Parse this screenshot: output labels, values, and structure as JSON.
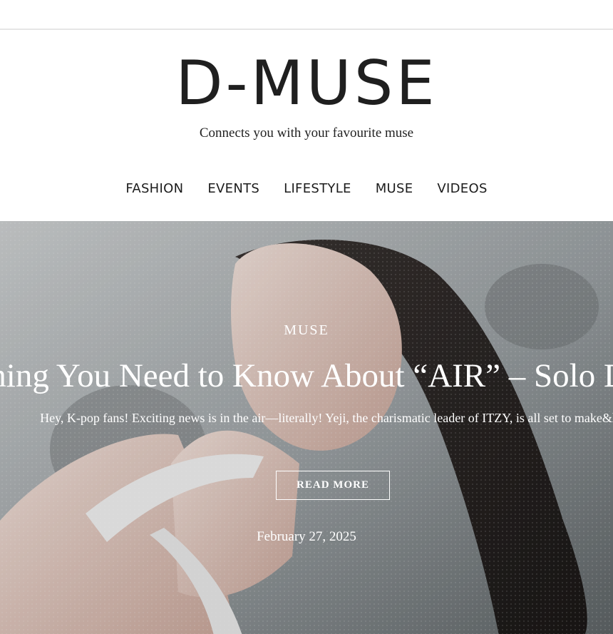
{
  "site": {
    "logo": "D-MUSE",
    "tagline": "Connects you with your favourite muse"
  },
  "nav": {
    "items": [
      {
        "label": "FASHION"
      },
      {
        "label": "EVENTS"
      },
      {
        "label": "LIFESTYLE"
      },
      {
        "label": "MUSE"
      },
      {
        "label": "VIDEOS"
      }
    ]
  },
  "hero": {
    "category": "MUSE",
    "headline": "Everything You Need to Know About “AIR” – Solo Debut",
    "excerpt": "Hey, K-pop fans! Exciting news is in the air—literally! Yeji, the charismatic leader of ITZY, is all set to make&h",
    "button_label": "READ MORE",
    "date": "February 27, 2025"
  },
  "colors": {
    "nav_text": "#1c1c1c",
    "logo_text": "#1f1f1f",
    "hero_text": "#ffffff"
  }
}
